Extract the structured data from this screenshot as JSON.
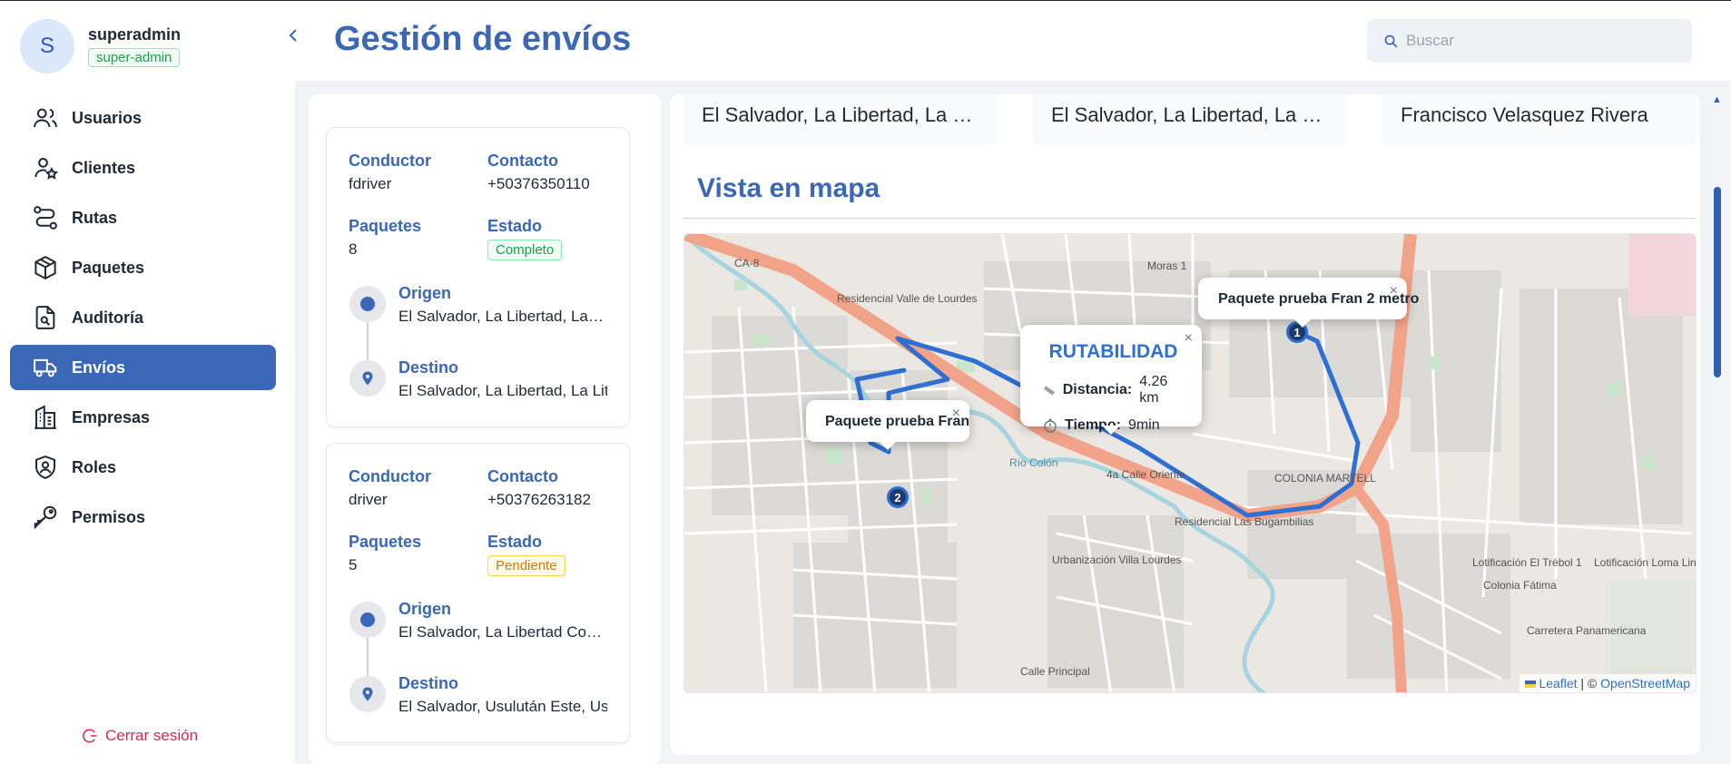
{
  "user": {
    "initial": "S",
    "name": "superadmin",
    "role": "super-admin"
  },
  "nav": {
    "items": [
      {
        "label": "Usuarios",
        "icon": "users-icon",
        "active": false
      },
      {
        "label": "Clientes",
        "icon": "user-star-icon",
        "active": false
      },
      {
        "label": "Rutas",
        "icon": "route-icon",
        "active": false
      },
      {
        "label": "Paquetes",
        "icon": "package-icon",
        "active": false
      },
      {
        "label": "Auditoría",
        "icon": "audit-file-icon",
        "active": false
      },
      {
        "label": "Envíos",
        "icon": "truck-icon",
        "active": true
      },
      {
        "label": "Empresas",
        "icon": "building-icon",
        "active": false
      },
      {
        "label": "Roles",
        "icon": "shield-user-icon",
        "active": false
      },
      {
        "label": "Permisos",
        "icon": "key-icon",
        "active": false
      }
    ],
    "logout_label": "Cerrar sesión"
  },
  "header": {
    "title": "Gestión de envíos",
    "search_placeholder": "Buscar"
  },
  "shipments": [
    {
      "driver_label": "Conductor",
      "driver": "fdriver",
      "contact_label": "Contacto",
      "contact": "+50376350110",
      "packages_label": "Paquetes",
      "packages": "8",
      "status_label": "Estado",
      "status": "Completo",
      "origin_label": "Origen",
      "origin": "El Salvador, La Libertad, La …",
      "destination_label": "Destino",
      "destination": "El Salvador, La Libertad, La Lit"
    },
    {
      "driver_label": "Conductor",
      "driver": "driver",
      "contact_label": "Contacto",
      "contact": "+50376263182",
      "packages_label": "Paquetes",
      "packages": "5",
      "status_label": "Estado",
      "status": "Pendiente",
      "origin_label": "Origen",
      "origin": "El Salvador, La Libertad Co…",
      "destination_label": "Destino",
      "destination": "El Salvador, Usulután Este, Us"
    }
  ],
  "detail": {
    "summary_boxes": [
      "El Salvador, La Libertad, La …",
      "El Salvador, La Libertad, La …",
      "Francisco Velasquez Rivera"
    ],
    "map_title": "Vista en mapa"
  },
  "map": {
    "labels": [
      "Residencial Valle de Lourdes",
      "Río Colón",
      "4a Calle Oriente",
      "COLONIA MARTELL",
      "Residencial Las Bugambilias",
      "Urbanización Villa Lourdes",
      "Lotificación El Trébol 1",
      "Lotificación Loma Linda II",
      "CA-8",
      "Moras 1",
      "Calle Principal",
      "Colonia Fátima",
      "Carretera Panamericana"
    ],
    "popup_1": "Paquete prueba Fran 2 metro",
    "popup_2": "Paquete prueba Fran",
    "route_info": {
      "title": "RUTABILIDAD",
      "distance_label": "Distancia:",
      "distance": "4.26 km",
      "time_label": "Tiempo:",
      "time": "9min"
    },
    "marker_1": "1",
    "marker_2": "2",
    "attribution_leaflet": "Leaflet",
    "attribution_sep": "| ©",
    "attribution_osm": "OpenStreetMap",
    "route_color": "#2f6fd1"
  }
}
